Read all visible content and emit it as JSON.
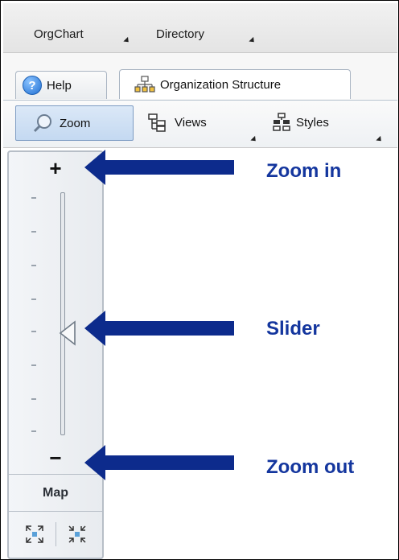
{
  "menubar": {
    "items": [
      {
        "label": "OrgChart"
      },
      {
        "label": "Directory"
      }
    ]
  },
  "tabs": [
    {
      "label": "Help",
      "icon": "help-icon"
    },
    {
      "label": "Organization Structure",
      "icon": "org-structure-icon",
      "active": true
    }
  ],
  "toolbar": {
    "zoom_label": "Zoom",
    "views_label": "Views",
    "styles_label": "Styles"
  },
  "zoom_panel": {
    "zoom_in_symbol": "+",
    "zoom_out_symbol": "−",
    "slider_level": 0.5,
    "map_label": "Map"
  },
  "callouts": {
    "zoom_in": "Zoom in",
    "slider": "Slider",
    "zoom_out": "Zoom out"
  },
  "colors": {
    "arrow": "#0d2b8c",
    "callout_text": "#14369e"
  }
}
